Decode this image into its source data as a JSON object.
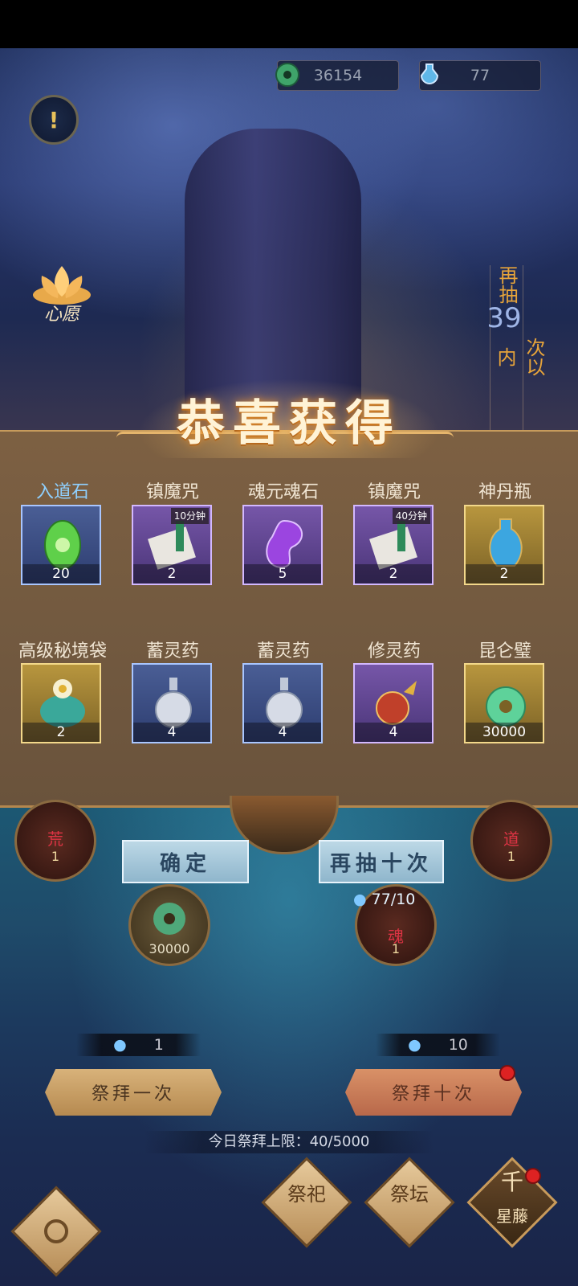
{
  "currencies": [
    {
      "icon": "jade-coin-icon",
      "value": "36154"
    },
    {
      "icon": "spirit-bottle-icon",
      "value": "77"
    }
  ],
  "wish": {
    "label": "心愿"
  },
  "side_banner": {
    "top": "再抽",
    "count": "39",
    "bottom": "次以内"
  },
  "popup": {
    "title": "恭喜获得",
    "rewards": [
      {
        "name": "入道石",
        "qty": "20",
        "rarity": "blue",
        "icon": "green-gem-icon"
      },
      {
        "name": "镇魔咒",
        "qty": "2",
        "rarity": "purple",
        "icon": "scroll-icon",
        "tag": "10分钟"
      },
      {
        "name": "魂元魂石",
        "qty": "5",
        "rarity": "purple",
        "icon": "purple-soul-stone-icon"
      },
      {
        "name": "镇魔咒",
        "qty": "2",
        "rarity": "purple",
        "icon": "scroll-icon",
        "tag": "40分钟"
      },
      {
        "name": "神丹瓶",
        "qty": "2",
        "rarity": "gold",
        "icon": "blue-vase-icon"
      },
      {
        "name": "高级秘境袋",
        "qty": "2",
        "rarity": "gold",
        "icon": "treasure-bag-icon"
      },
      {
        "name": "蓄灵药",
        "qty": "4",
        "rarity": "blue",
        "icon": "potion-gourd-icon"
      },
      {
        "name": "蓄灵药",
        "qty": "4",
        "rarity": "blue",
        "icon": "potion-gourd-icon"
      },
      {
        "name": "修灵药",
        "qty": "4",
        "rarity": "purple",
        "icon": "fire-gourd-icon"
      },
      {
        "name": "昆仑璧",
        "qty": "30000",
        "rarity": "gold",
        "icon": "jade-disc-icon"
      }
    ]
  },
  "orbs": [
    {
      "glyph": "荒",
      "label": "1"
    },
    {
      "glyph": "道",
      "label": "1"
    },
    {
      "glyph": "",
      "label": "30000"
    },
    {
      "glyph": "魂",
      "label": "1"
    }
  ],
  "confirm_label": "确定",
  "redraw_label": "再抽十次",
  "redraw_cost": "77/10",
  "pray_once": {
    "cost": "1",
    "label": "祭拜一次"
  },
  "pray_ten": {
    "cost": "10",
    "label": "祭拜十次"
  },
  "daily_limit": "今日祭拜上限：40/5000",
  "nav": {
    "sacrifice": "祭祀",
    "altar": "祭坛",
    "vine_top": "千",
    "vine_bottom": "星藤"
  }
}
